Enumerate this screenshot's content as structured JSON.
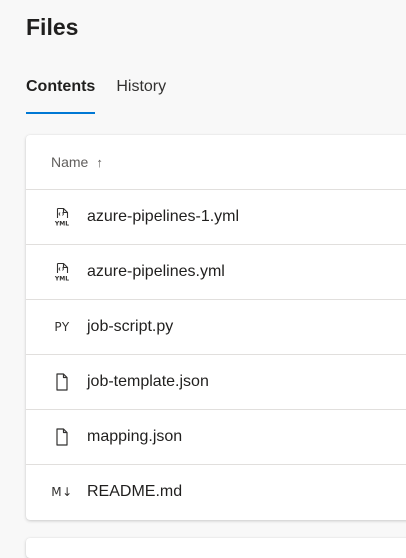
{
  "page": {
    "title": "Files"
  },
  "tabs": [
    {
      "label": "Contents",
      "active": true
    },
    {
      "label": "History",
      "active": false
    }
  ],
  "table": {
    "column_header": "Name",
    "sort_indicator": "↑",
    "rows": [
      {
        "name": "azure-pipelines-1.yml",
        "icon": "yml-file-icon"
      },
      {
        "name": "azure-pipelines.yml",
        "icon": "yml-file-icon"
      },
      {
        "name": "job-script.py",
        "icon": "python-file-icon",
        "icon_text": "PY"
      },
      {
        "name": "job-template.json",
        "icon": "file-icon"
      },
      {
        "name": "mapping.json",
        "icon": "file-icon"
      },
      {
        "name": "README.md",
        "icon": "markdown-file-icon",
        "icon_text": "M↓"
      }
    ]
  },
  "colors": {
    "accent": "#0078d4",
    "background": "#f8f8f8",
    "card": "#ffffff"
  }
}
